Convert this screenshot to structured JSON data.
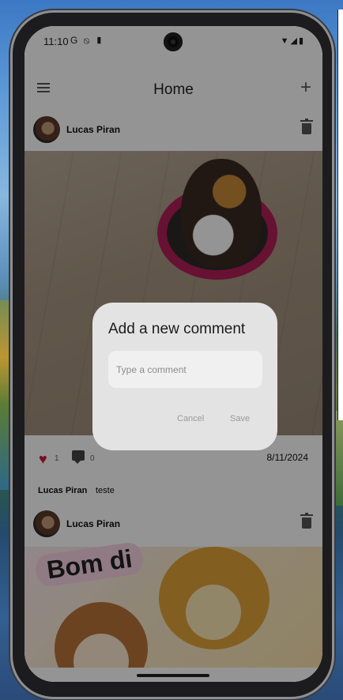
{
  "status": {
    "time": "11:10",
    "left_icons": "G ⦸ ▮",
    "right_icons": "▼◢▮"
  },
  "appbar": {
    "title": "Home",
    "add_symbol": "+"
  },
  "posts": [
    {
      "author": "Lucas Piran",
      "likes": "1",
      "comments": "0",
      "date": "8/11/2024",
      "comment": {
        "author": "Lucas Piran",
        "text": "teste"
      }
    },
    {
      "author": "Lucas Piran",
      "sticker_text": "Bom di"
    }
  ],
  "dialog": {
    "title": "Add a new comment",
    "input_placeholder": "Type a comment",
    "input_value": "",
    "cancel_label": "Cancel",
    "save_label": "Save"
  },
  "icons": {
    "menu": "menu-icon",
    "add": "add-icon",
    "delete": "trash-icon",
    "like": "heart-icon",
    "comment": "comment-icon"
  },
  "colors": {
    "like_active": "#d1193a",
    "dialog_bg": "#e3e3e3",
    "scrim": "rgba(0,0,0,0.42)"
  }
}
